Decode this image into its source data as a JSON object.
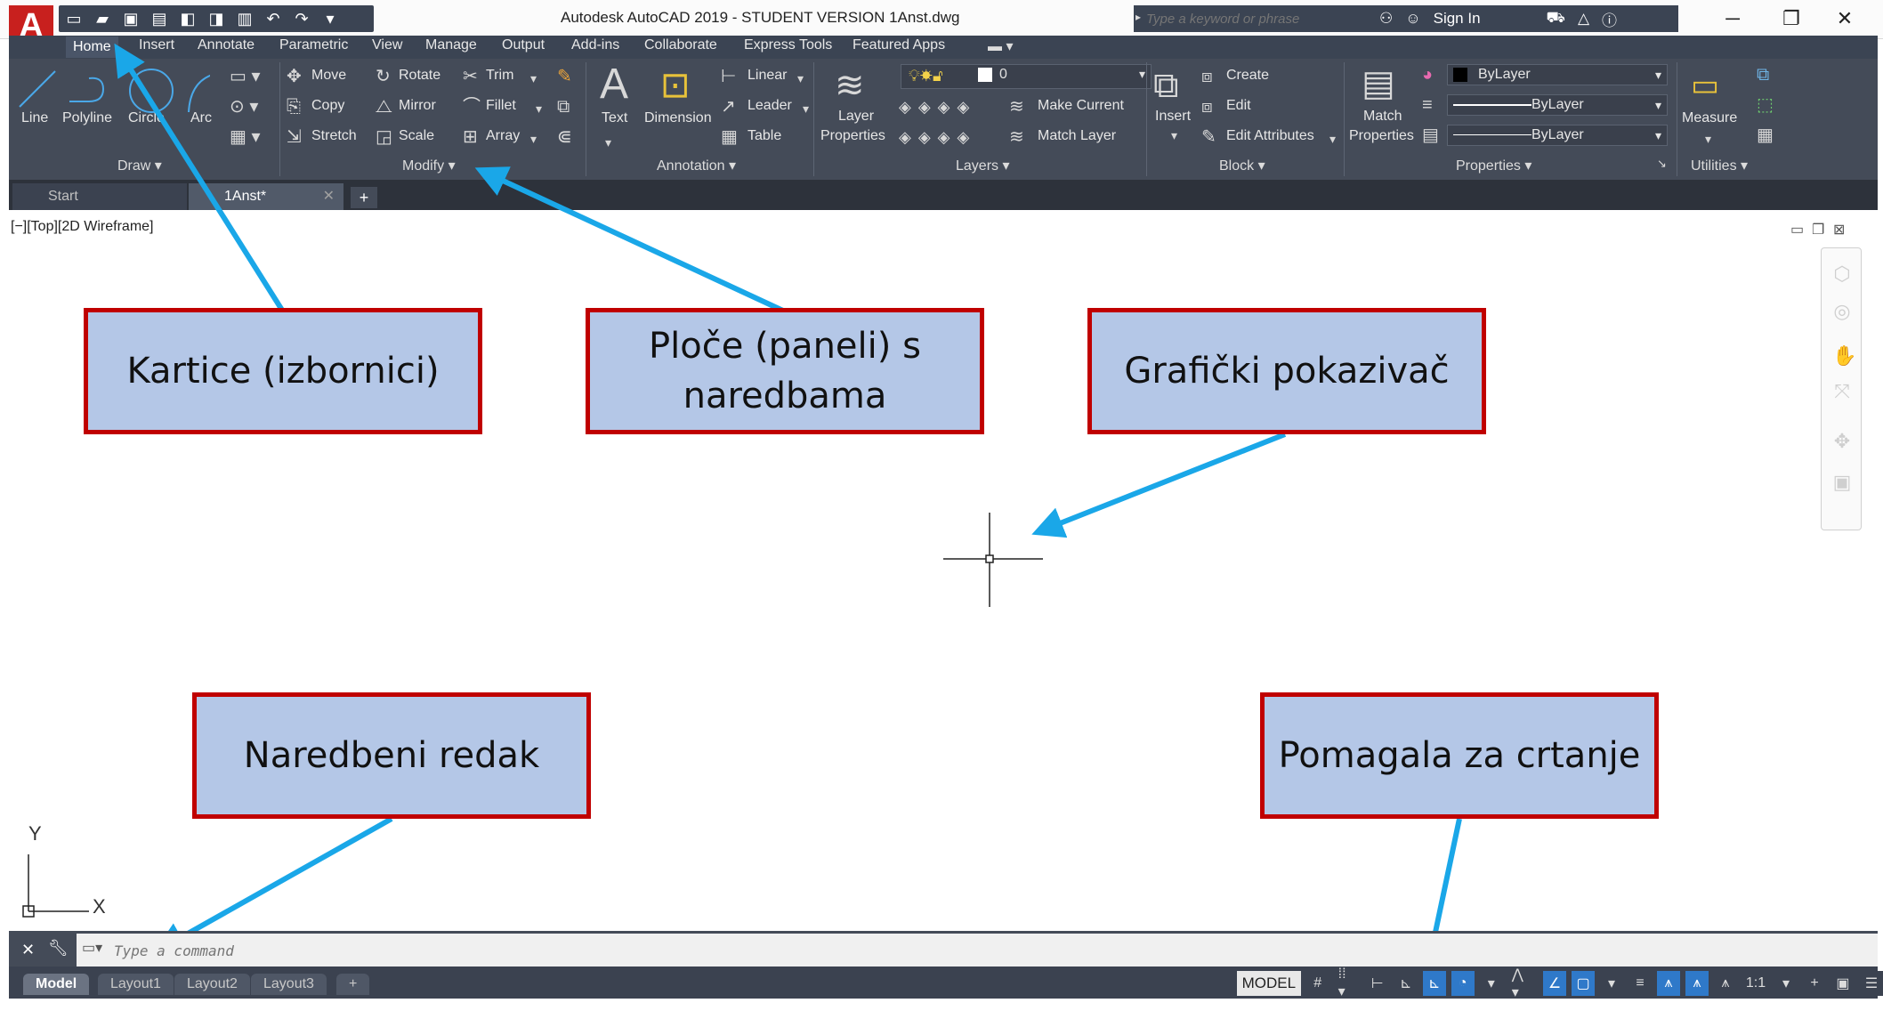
{
  "title_bar": {
    "window_title": "Autodesk AutoCAD 2019 - STUDENT VERSION    1Anst.dwg",
    "search_placeholder": "Type a keyword or phrase",
    "sign_in": "Sign In",
    "app_letter": "A"
  },
  "tabs": [
    "Home",
    "Insert",
    "Annotate",
    "Parametric",
    "View",
    "Manage",
    "Output",
    "Add-ins",
    "Collaborate",
    "Express Tools",
    "Featured Apps"
  ],
  "ribbon": {
    "draw": {
      "title": "Draw",
      "line": "Line",
      "polyline": "Polyline",
      "circle": "Circle",
      "arc": "Arc"
    },
    "modify": {
      "title": "Modify",
      "move": "Move",
      "rotate": "Rotate",
      "trim": "Trim",
      "copy": "Copy",
      "mirror": "Mirror",
      "fillet": "Fillet",
      "stretch": "Stretch",
      "scale": "Scale",
      "array": "Array"
    },
    "annotation": {
      "title": "Annotation",
      "text": "Text",
      "dimension": "Dimension",
      "linear": "Linear",
      "leader": "Leader",
      "table": "Table"
    },
    "layers": {
      "title": "Layers",
      "layer_properties_1": "Layer",
      "layer_properties_2": "Properties",
      "current_layer": "0",
      "make_current": "Make Current",
      "match_layer": "Match Layer"
    },
    "block": {
      "title": "Block",
      "insert": "Insert",
      "create": "Create",
      "edit": "Edit",
      "edit_attributes": "Edit Attributes"
    },
    "properties": {
      "title": "Properties",
      "match_1": "Match",
      "match_2": "Properties",
      "color": "ByLayer",
      "linetype": "ByLayer",
      "lineweight": "ByLayer"
    },
    "utilities": {
      "title": "Utilities",
      "measure": "Measure"
    }
  },
  "file_tabs": {
    "start": "Start",
    "file": "1Anst*"
  },
  "viewport_label": "[−][Top][2D Wireframe]",
  "callouts": {
    "tabs": "Kartice (izbornici)",
    "panels": "Ploče (paneli) s naredbama",
    "cursor": "Grafički pokazivač",
    "command": "Naredbeni redak",
    "aids": "Pomagala za crtanje"
  },
  "ucs": {
    "x": "X",
    "y": "Y"
  },
  "command_line": {
    "placeholder": "Type a command"
  },
  "layout_tabs": [
    "Model",
    "Layout1",
    "Layout2",
    "Layout3"
  ],
  "status_bar": {
    "model": "MODEL",
    "scale": "1:1"
  },
  "colors": {
    "callout_fill": "#b4c7e7",
    "callout_border": "#c00000",
    "arrow": "#1aa7e8",
    "ribbon_bg": "#444b58",
    "app_button": "#c8201e"
  }
}
